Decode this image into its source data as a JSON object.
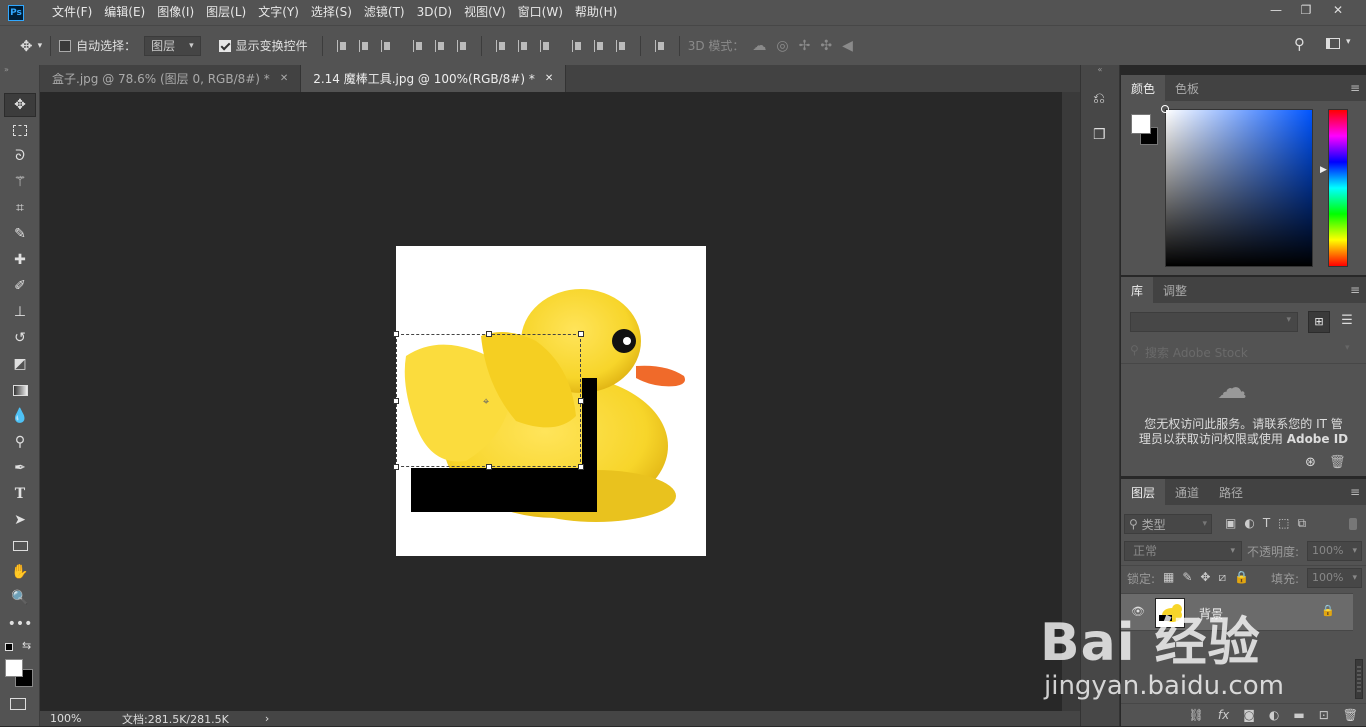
{
  "app": {
    "logo": "Ps"
  },
  "menu": [
    "文件(F)",
    "编辑(E)",
    "图像(I)",
    "图层(L)",
    "文字(Y)",
    "选择(S)",
    "滤镜(T)",
    "3D(D)",
    "视图(V)",
    "窗口(W)",
    "帮助(H)"
  ],
  "options": {
    "auto_select_label": "自动选择：",
    "auto_select_checked": false,
    "layer_select": "图层",
    "show_transform_label": "显示变换控件",
    "show_transform_checked": true,
    "mode3d_label": "3D 模式："
  },
  "tabs": [
    {
      "label": "盒子.jpg @ 78.6% (图层 0, RGB/8#) *",
      "active": false
    },
    {
      "label": "2.14 魔棒工具.jpg @ 100%(RGB/8#) *",
      "active": true
    }
  ],
  "status": {
    "zoom": "100%",
    "doc_info": "文档:281.5K/281.5K"
  },
  "color_panel": {
    "tabs": [
      "颜色",
      "色板"
    ]
  },
  "library_panel": {
    "tabs": [
      "库",
      "调整"
    ],
    "search_placeholder": "搜索 Adobe Stock",
    "message_line1": "您无权访问此服务。请联系您的 IT 管",
    "message_line2_a": "理员以获取访问权限或使用",
    "message_line2_b": "Adobe ID"
  },
  "layers_panel": {
    "tabs": [
      "图层",
      "通道",
      "路径"
    ],
    "filter_label": "类型",
    "blend_mode": "正常",
    "opacity_label": "不透明度:",
    "opacity_value": "100%",
    "lock_label": "锁定:",
    "fill_label": "填充:",
    "fill_value": "100%",
    "layers": [
      {
        "name": "背景",
        "locked": true,
        "visible": true
      }
    ]
  },
  "watermark": {
    "brand": "Bai 经验",
    "url": "jingyan.baidu.com"
  },
  "colors": {
    "foreground": "#ffffff",
    "background": "#000000",
    "duck": "#f7d52a",
    "beak": "#f06a2a"
  }
}
